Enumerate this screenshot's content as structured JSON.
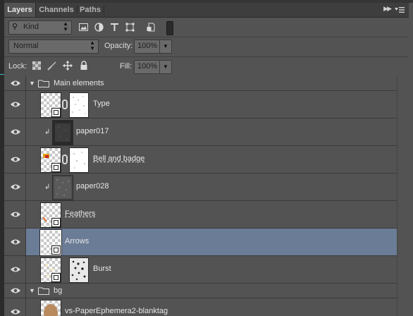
{
  "panel": {
    "tabs": [
      {
        "label": "Layers",
        "active": true
      },
      {
        "label": "Channels",
        "active": false
      },
      {
        "label": "Paths",
        "active": false
      }
    ]
  },
  "filter": {
    "kind_label": "Kind",
    "icons": [
      "pixel-layer-filter-icon",
      "adjustment-layer-filter-icon",
      "type-layer-filter-icon",
      "shape-layer-filter-icon",
      "smart-object-filter-icon",
      "filter-toggle-icon"
    ]
  },
  "blend": {
    "mode": "Normal",
    "opacity_label": "Opacity:",
    "opacity_value": "100%",
    "fill_label": "Fill:",
    "fill_value": "100%"
  },
  "lock": {
    "label": "Lock:",
    "icons": [
      "lock-transparent-pixels-icon",
      "lock-image-pixels-icon",
      "lock-position-icon",
      "lock-all-icon"
    ]
  },
  "layers": [
    {
      "name": "Main elements",
      "kind": "group",
      "expanded": true,
      "visible": true
    },
    {
      "name": "Type",
      "kind": "smart",
      "visible": true,
      "has_mask": true,
      "mask": "speckle-white"
    },
    {
      "name": "paper017",
      "kind": "clipped",
      "visible": true,
      "thumb": "dark-texture"
    },
    {
      "name": "Bell and badge",
      "kind": "smart",
      "visible": true,
      "has_mask": true,
      "mask": "speckle-white",
      "underlined": true
    },
    {
      "name": "paper028",
      "kind": "clipped",
      "visible": true,
      "thumb": "gray-texture"
    },
    {
      "name": "Feathers",
      "kind": "smart",
      "visible": true,
      "has_mask": false,
      "underlined": true
    },
    {
      "name": "Arrows",
      "kind": "smart",
      "visible": true,
      "has_mask": false,
      "selected": true
    },
    {
      "name": "Burst",
      "kind": "smart",
      "visible": true,
      "has_mask": true,
      "mask": "speckle-dark"
    },
    {
      "name": "bg",
      "kind": "group",
      "expanded": true,
      "visible": true
    },
    {
      "name": "vs-PaperEphemera2-blanktag",
      "kind": "smart",
      "visible": true
    }
  ],
  "colors": {
    "panel_bg": "#535353",
    "selected_row": "#6b7d96",
    "tab_bar": "#3e3e3e"
  }
}
